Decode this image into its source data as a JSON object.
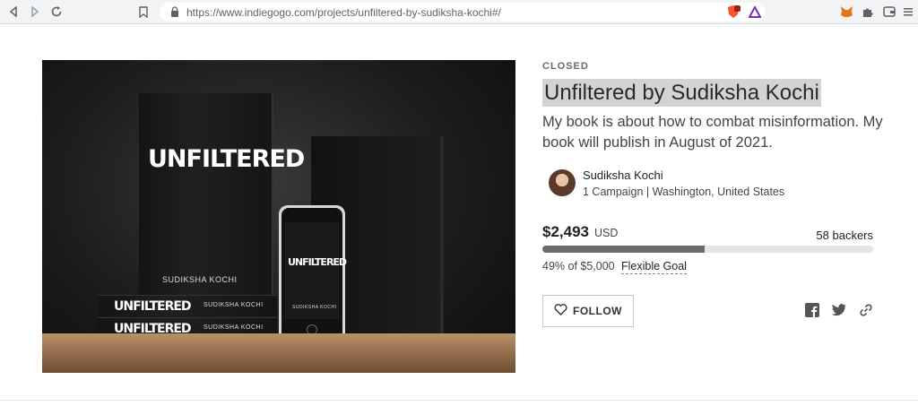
{
  "browser": {
    "url": "https://www.indiegogo.com/projects/unfiltered-by-sudiksha-kochi#/"
  },
  "campaign": {
    "status": "CLOSED",
    "title": "Unfiltered by Sudiksha Kochi",
    "description": "My book is about how to combat misinformation. My book will publish in August of 2021.",
    "owner_name": "Sudiksha Kochi",
    "owner_meta": "1 Campaign | Washington, United States",
    "amount": "$2,493",
    "currency": "USD",
    "backers": "58 backers",
    "percent_text": "49% of $5,000",
    "goal_type": "Flexible Goal",
    "progress_fraction": 0.49,
    "follow_label": "FOLLOW"
  },
  "hero": {
    "book_title": "UNFILTERED",
    "book_author": "SUDIKSHA KOCHI"
  },
  "icons": [
    "back-icon",
    "forward-icon",
    "reload-icon",
    "bookmark-icon",
    "lock-icon",
    "brave-shield-icon",
    "brave-rewards-icon",
    "metamask-icon",
    "extensions-icon",
    "wallet-icon",
    "menu-icon",
    "heart-icon",
    "facebook-icon",
    "twitter-icon",
    "link-icon"
  ]
}
